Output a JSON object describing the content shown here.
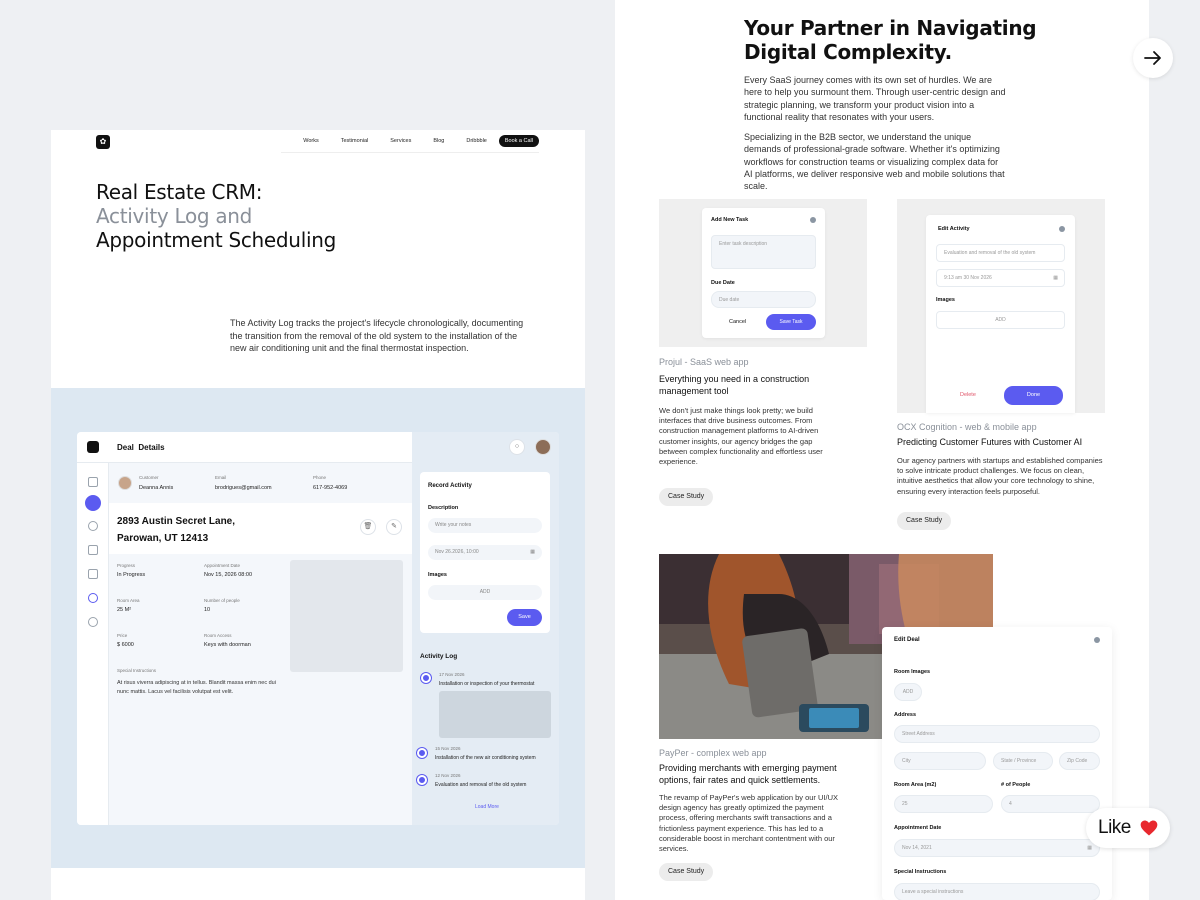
{
  "left": {
    "nav": {
      "links": [
        "Works",
        "Testimonial",
        "Services",
        "Blog",
        "Dribbble"
      ],
      "cta": "Book a Call"
    },
    "headline": {
      "line1": "Real Estate CRM:",
      "line2": "Activity Log and",
      "line3": "Appointment Scheduling"
    },
    "lead": "The Activity Log tracks the project's lifecycle chronologically, documenting the transition from the removal of the old system to the installation of the new air conditioning unit and the final thermostat inspection.",
    "crm": {
      "title_a": "Deal",
      "title_b": "Details",
      "customer_cap": "Customer",
      "customer": "Deanna Annis",
      "email_cap": "Email",
      "email": "brodrigues@gmail.com",
      "phone_cap": "Phone",
      "phone": "617-952-4069",
      "address_l1": "2893 Austin Secret Lane,",
      "address_l2": "Parowan, UT 12413",
      "progress_cap": "Progress",
      "progress": "In Progress",
      "appt_cap": "Appointment Date",
      "appt": "Nov 15, 2026 08:00",
      "room_cap": "Room Area",
      "room": "25 M²",
      "people_cap": "Number of people",
      "people": "10",
      "price_cap": "Price",
      "price": "$ 6000",
      "access_cap": "Room Access",
      "access": "Keys with doorman",
      "special_cap": "Special Instructions",
      "special": "At risus viverra adipiscing at in tellus. Blandit massa enim nec dui nunc mattis. Lacus vel facilisis volutpat est velit.",
      "record_title": "Record Activity",
      "desc_label": "Description",
      "notes_ph": "Write your notes",
      "date_val": "Nov 26.2026, 10:00",
      "images_label": "Images",
      "add": "ADD",
      "save": "Save",
      "log_title": "Activity Log",
      "log": [
        {
          "date": "17 Nov 2026",
          "text": "Installation or inspection of your thermostat"
        },
        {
          "date": "15 Nov 2026",
          "text": "Installation of the new air conditioning system"
        },
        {
          "date": "12 Nov 2026",
          "text": "Evaluation and removal of the old system"
        }
      ],
      "load_more": "Load More"
    }
  },
  "right": {
    "title_l1": "Your Partner in Navigating",
    "title_l2": "Digital Complexity.",
    "p1": "Every SaaS journey comes with its own set of hurdles. We are here to help you surmount them. Through user-centric design and strategic planning, we transform your product vision into a functional reality that resonates with your users.",
    "p2": "Specializing in the B2B sector, we understand the unique demands of professional-grade software. Whether it's optimizing workflows for construction teams or visualizing complex data for AI platforms, we deliver responsive web and mobile solutions that scale.",
    "task_modal": {
      "title": "Add New Task",
      "desc_ph": "Enter task description",
      "due_label": "Due Date",
      "due_ph": "Due date",
      "cancel": "Cancel",
      "save": "Save Task"
    },
    "activity_modal": {
      "title": "Edit Activity",
      "field1": "Evaluation and removal of the old system",
      "field2": "9:13 am 30 Nov 2026",
      "images": "Images",
      "add": "ADD",
      "delete": "Delete",
      "done": "Done"
    },
    "case1": {
      "tag": "Projul - SaaS web app",
      "title": "Everything you need in a construction management tool",
      "desc": "We don't just make things look pretty; we build interfaces that drive business outcomes. From construction management platforms to AI-driven customer insights, our agency bridges the gap between complex functionality and effortless user experience.",
      "btn": "Case Study"
    },
    "case2": {
      "tag": "OCX Cognition - web & mobile app",
      "title": "Predicting Customer Futures with Customer AI",
      "desc": "Our agency partners with startups and established companies to solve intricate product challenges. We focus on clean, intuitive aesthetics that allow your core technology to shine, ensuring every interaction feels purposeful.",
      "btn": "Case Study"
    },
    "case3": {
      "tag": "PayPer - complex web app",
      "title": "Providing merchants with emerging payment options, fair rates and quick settlements.",
      "desc": "The revamp of PayPer's web application by our UI/UX design agency has greatly optimized the payment process, offering merchants swift transactions and a frictionless payment experience. This has led to a considerable boost in merchant contentment with our services.",
      "btn": "Case Study"
    },
    "edit_deal": {
      "title": "Edit Deal",
      "room_images": "Room Images",
      "add": "ADD",
      "address": "Address",
      "street_ph": "Street Address",
      "city_ph": "City",
      "state_ph": "State / Province",
      "zip_ph": "Zip Code",
      "area_label": "Room Area (m2)",
      "area_val": "25",
      "people_label": "# of People",
      "people_val": "4",
      "appt_label": "Appointment Date",
      "appt_val": "Nov 14, 2021",
      "special_label": "Special Instructions",
      "special_ph": "Leave a special instructions"
    }
  },
  "like_label": "Like",
  "colors": {
    "accent": "#5b5bf0",
    "band": "#dde8f2",
    "heart": "#e8282e"
  }
}
